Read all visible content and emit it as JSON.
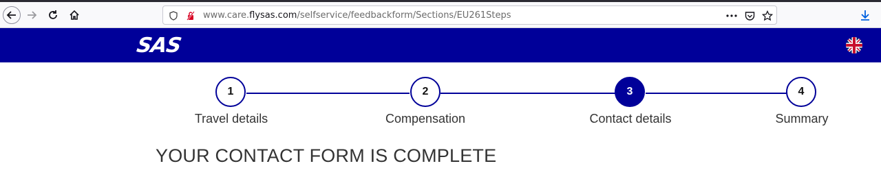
{
  "browser": {
    "url_prefix": "www.care.",
    "url_domain": "flysas.com",
    "url_path": "/selfservice/feedbackform/Sections/EU261Steps",
    "icons": [
      "back-icon",
      "forward-icon",
      "reload-icon",
      "home-icon",
      "shield-icon",
      "tracking-blocked-icon",
      "more-icon",
      "pocket-icon",
      "bookmark-star-icon",
      "download-icon"
    ]
  },
  "header": {
    "logo_text": "SAS",
    "language_icon": "uk-flag-icon",
    "brand_color": "#000099"
  },
  "stepper": {
    "steps": [
      {
        "number": "1",
        "label": "Travel details",
        "active": false
      },
      {
        "number": "2",
        "label": "Compensation",
        "active": false
      },
      {
        "number": "3",
        "label": "Contact details",
        "active": true
      },
      {
        "number": "4",
        "label": "Summary",
        "active": false
      }
    ]
  },
  "main": {
    "title": "YOUR CONTACT FORM IS COMPLETE"
  }
}
